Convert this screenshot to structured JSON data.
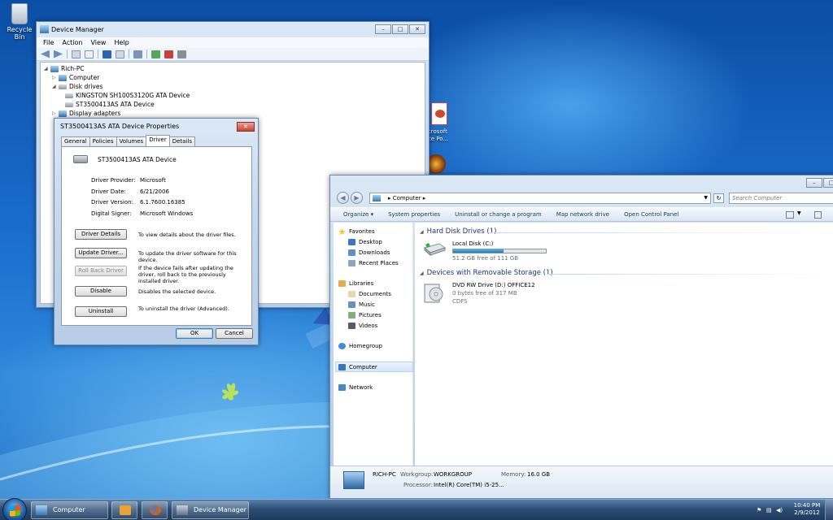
{
  "desktop": {
    "recycle_bin_label": "Recycle Bin",
    "partial_icon_label_line1": "icrosoft",
    "partial_icon_label_line2": "ice Po..."
  },
  "device_manager": {
    "title": "Device Manager",
    "menu": [
      "File",
      "Action",
      "View",
      "Help"
    ],
    "tree": {
      "root": "Rich-PC",
      "computer": "Computer",
      "disk_drives": "Disk drives",
      "disk1": "KINGSTON SH100S3120G ATA Device",
      "disk2": "ST3500413AS ATA Device",
      "display_adapters": "Display adapters"
    },
    "caption": {
      "minimize": "–",
      "maximize": "□",
      "close": "✕"
    }
  },
  "properties": {
    "title": "ST3500413AS ATA Device Properties",
    "close": "✕",
    "tabs": [
      "General",
      "Policies",
      "Volumes",
      "Driver",
      "Details"
    ],
    "active_tab": "Driver",
    "device_name": "ST3500413AS ATA Device",
    "info": [
      {
        "key": "Driver Provider:",
        "value": "Microsoft"
      },
      {
        "key": "Driver Date:",
        "value": "6/21/2006"
      },
      {
        "key": "Driver Version:",
        "value": "6.1.7600.16385"
      },
      {
        "key": "Digital Signer:",
        "value": "Microsoft Windows"
      }
    ],
    "actions": [
      {
        "label": "Driver Details",
        "desc": "To view details about the driver files."
      },
      {
        "label": "Update Driver...",
        "desc": "To update the driver software for this device."
      },
      {
        "label": "Roll Back Driver",
        "desc": "If the device fails after updating the driver, roll back to the previously installed driver."
      },
      {
        "label": "Disable",
        "desc": "Disables the selected device."
      },
      {
        "label": "Uninstall",
        "desc": "To uninstall the driver (Advanced)."
      }
    ],
    "ok": "OK",
    "cancel": "Cancel"
  },
  "explorer": {
    "caption": {
      "minimize": "–",
      "maximize": "□"
    },
    "address": "▸  Computer  ▸",
    "search_placeholder": "Search Computer",
    "commands": [
      "Organize ▾",
      "System properties",
      "Uninstall or change a program",
      "Map network drive",
      "Open Control Panel"
    ],
    "nav": {
      "favorites": "Favorites",
      "desktop": "Desktop",
      "downloads": "Downloads",
      "recent": "Recent Places",
      "libraries": "Libraries",
      "documents": "Documents",
      "music": "Music",
      "pictures": "Pictures",
      "videos": "Videos",
      "homegroup": "Homegroup",
      "computer": "Computer",
      "network": "Network"
    },
    "groups": {
      "hdd": "Hard Disk Drives (1)",
      "removable": "Devices with Removable Storage (1)"
    },
    "local_disk": {
      "name": "Local Disk (C:)",
      "free": "51.2 GB free of 111 GB",
      "used_fraction": 0.54
    },
    "dvd": {
      "name": "DVD RW Drive (D:) OFFICE12",
      "free": "0 bytes free of 317 MB",
      "fs": "CDFS"
    },
    "details": {
      "pc_name": "RICH-PC",
      "workgroup_label": "Workgroup:",
      "workgroup": "WORKGROUP",
      "memory_label": "Memory:",
      "memory": "16.0 GB",
      "processor_label": "Processor:",
      "processor": "Intel(R) Core(TM) i5-25..."
    }
  },
  "taskbar": {
    "computer": "Computer",
    "device_manager": "Device Manager",
    "time": "10:40 PM",
    "date": "2/9/2012"
  },
  "colors": {
    "accent": "#1e3287",
    "desktop_blue": "#1a6ccc"
  }
}
